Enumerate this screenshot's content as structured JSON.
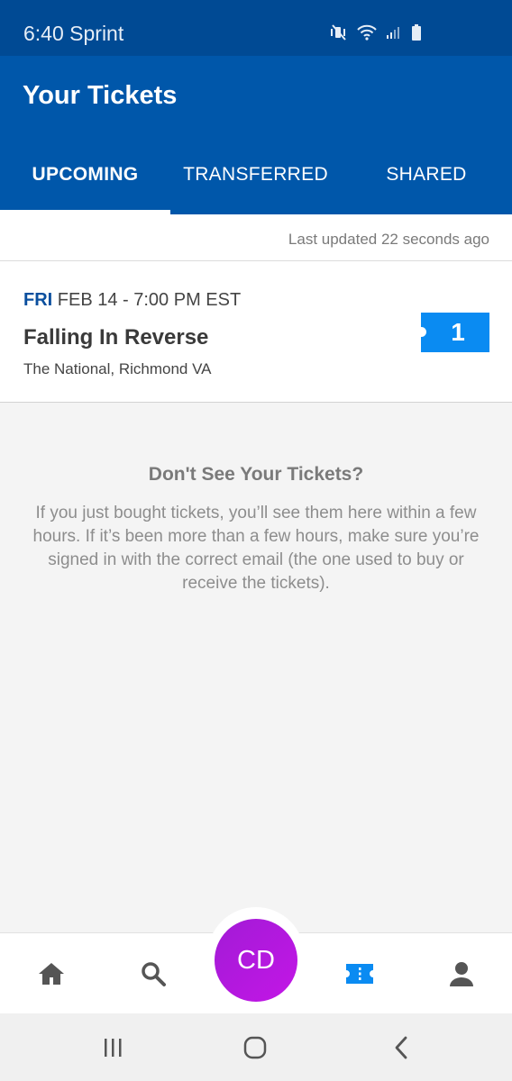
{
  "status_bar": {
    "time": "6:40",
    "carrier": "Sprint",
    "icons": [
      "mute-vibrate-icon",
      "wifi-icon",
      "cell-signal-icon",
      "battery-icon"
    ]
  },
  "header": {
    "title": "Your Tickets",
    "tabs": [
      {
        "label": "UPCOMING",
        "active": true
      },
      {
        "label": "TRANSFERRED",
        "active": false
      },
      {
        "label": "SHARED",
        "active": false
      }
    ]
  },
  "last_updated": "Last updated 22 seconds ago",
  "events": [
    {
      "day": "FRI",
      "date": "FEB 14 - 7:00 PM EST",
      "name": "Falling In Reverse",
      "venue": "The National, Richmond VA",
      "ticket_count": "1"
    }
  ],
  "help": {
    "title": "Don't See Your Tickets?",
    "text": "If you just bought tickets, you’ll see them here within a few hours. If it’s been more than a few hours, make sure you’re signed in with the correct email (the one used to buy or receive the tickets)."
  },
  "bottom_nav": {
    "items": [
      "home-icon",
      "search-icon",
      "tickets-icon",
      "account-icon"
    ],
    "avatar_initials": "CD",
    "active_item": "tickets-icon"
  },
  "system_nav": [
    "recent-apps-icon",
    "home-circle-icon",
    "back-icon"
  ],
  "colors": {
    "header": "#0057aa",
    "status_bar": "#004a94",
    "accent_blue": "#0a8bf2",
    "avatar": "#b31ade"
  }
}
